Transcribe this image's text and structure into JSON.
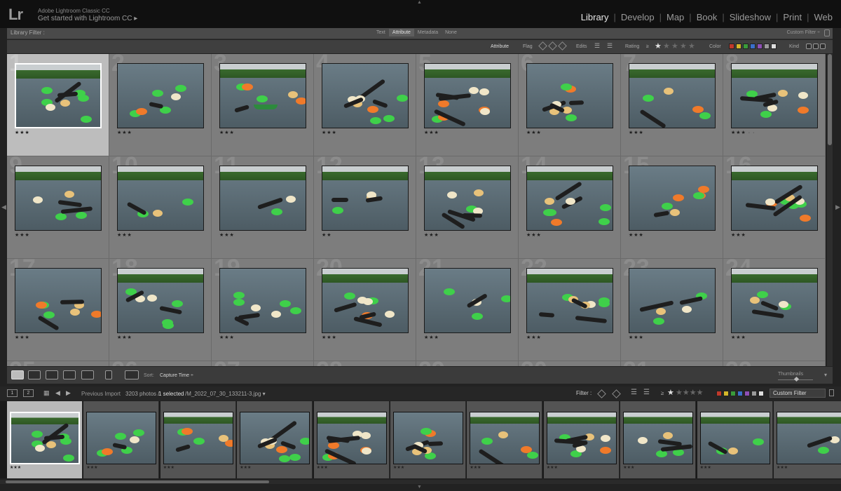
{
  "identity": {
    "logo": "Lr",
    "app_name": "Adobe Lightroom Classic CC",
    "get_started": "Get started with Lightroom CC ▸"
  },
  "modules": [
    "Library",
    "Develop",
    "Map",
    "Book",
    "Slideshow",
    "Print",
    "Web"
  ],
  "active_module": "Library",
  "library_filter": {
    "title": "Library Filter :",
    "tabs": [
      "Text",
      "Attribute",
      "Metadata",
      "None"
    ],
    "active_tab": "Attribute",
    "preset": "Custom Filter ÷"
  },
  "attribute_bar": {
    "attribute_label": "Attribute",
    "flag_label": "Flag",
    "edits_label": "Edits",
    "rating_label": "Rating",
    "rating_op": "≥",
    "color_label": "Color",
    "kind_label": "Kind",
    "colors": [
      "#c0392b",
      "#d4b72a",
      "#3a9a3a",
      "#3a6fc9",
      "#8e4fb5",
      "#9a9a9a",
      "#dddddd"
    ]
  },
  "grid": {
    "cells": [
      {
        "num": "1",
        "stars": "★★★",
        "selected": true
      },
      {
        "num": "2",
        "stars": "★★★"
      },
      {
        "num": "3",
        "stars": "★★★"
      },
      {
        "num": "4",
        "stars": "★★★"
      },
      {
        "num": "5",
        "stars": "★★★"
      },
      {
        "num": "6",
        "stars": "★★★"
      },
      {
        "num": "7",
        "stars": "★★★"
      },
      {
        "num": "8",
        "stars": "★★★ · ·"
      },
      {
        "num": "9",
        "stars": "★★★"
      },
      {
        "num": "10",
        "stars": "★★★"
      },
      {
        "num": "11",
        "stars": "★★★"
      },
      {
        "num": "12",
        "stars": "★★"
      },
      {
        "num": "13",
        "stars": "★★★"
      },
      {
        "num": "14",
        "stars": "★★★"
      },
      {
        "num": "15",
        "stars": "★★★"
      },
      {
        "num": "16",
        "stars": "★★★"
      },
      {
        "num": "17",
        "stars": "★★★"
      },
      {
        "num": "18",
        "stars": "★★★"
      },
      {
        "num": "19",
        "stars": "★★★"
      },
      {
        "num": "20",
        "stars": "★★★"
      },
      {
        "num": "21",
        "stars": "★★★"
      },
      {
        "num": "22",
        "stars": "★★★"
      },
      {
        "num": "23",
        "stars": "★★★"
      },
      {
        "num": "24",
        "stars": "★★★"
      },
      {
        "num": "25",
        "stars": ""
      },
      {
        "num": "26",
        "stars": ""
      },
      {
        "num": "27",
        "stars": ""
      },
      {
        "num": "28",
        "stars": ""
      },
      {
        "num": "29",
        "stars": ""
      },
      {
        "num": "30",
        "stars": ""
      },
      {
        "num": "31",
        "stars": ""
      },
      {
        "num": "32",
        "stars": ""
      }
    ]
  },
  "toolbar": {
    "sort_label": "Sort:",
    "sort_value": "Capture Time ÷",
    "thumbnails_label": "Thumbnails"
  },
  "filmstrip_bar": {
    "page1": "1",
    "page2": "2",
    "source": "Previous Import",
    "count": "3203 photos /",
    "selected": "1 selected",
    "filename": "/M_2022_07_30_133211-3.jpg ▾",
    "filter_label": "Filter :",
    "rating_op": "≥",
    "preset": "Custom Filter"
  },
  "filmstrip": [
    {
      "stars": "★★★",
      "selected": true
    },
    {
      "stars": "★★★"
    },
    {
      "stars": "★★★"
    },
    {
      "stars": "★★★"
    },
    {
      "stars": "★★★"
    },
    {
      "stars": "★★★"
    },
    {
      "stars": "★★★"
    },
    {
      "stars": "★★★"
    },
    {
      "stars": "★★★"
    },
    {
      "stars": "★★★"
    },
    {
      "stars": "★★★"
    }
  ]
}
